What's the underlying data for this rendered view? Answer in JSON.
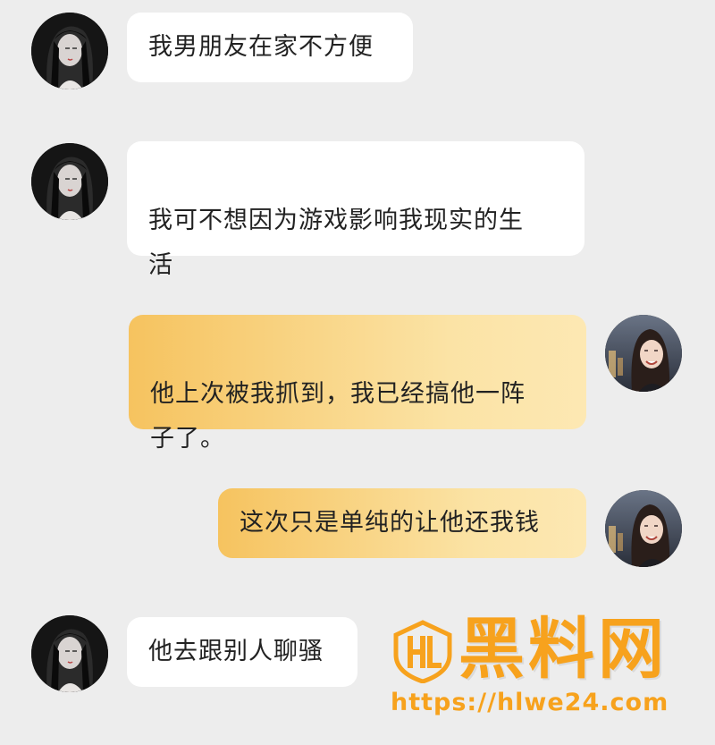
{
  "messages": [
    {
      "side": "incoming",
      "avatar": "girl-sketch-avatar",
      "text": "我男朋友在家不方便"
    },
    {
      "side": "incoming",
      "avatar": "girl-sketch-avatar",
      "text": "我可不想因为游戏影响我现实的生\n活"
    },
    {
      "side": "outgoing",
      "avatar": "smiling-girl-photo-avatar",
      "text": "他上次被我抓到，我已经搞他一阵\n子了。"
    },
    {
      "side": "outgoing",
      "avatar": "smiling-girl-photo-avatar",
      "text": "这次只是单纯的让他还我钱"
    },
    {
      "side": "incoming",
      "avatar": "girl-sketch-avatar",
      "text": "他去跟别人聊骚"
    }
  ],
  "watermark": {
    "title": "黑料网",
    "url": "https://hlwe24.com",
    "logo": "hl-shield-logo"
  },
  "colors": {
    "background": "#ededed",
    "incoming_bubble": "#ffffff",
    "outgoing_bubble_start": "#f6c35f",
    "outgoing_bubble_end": "#fde8b3",
    "watermark": "#f7a21d"
  }
}
